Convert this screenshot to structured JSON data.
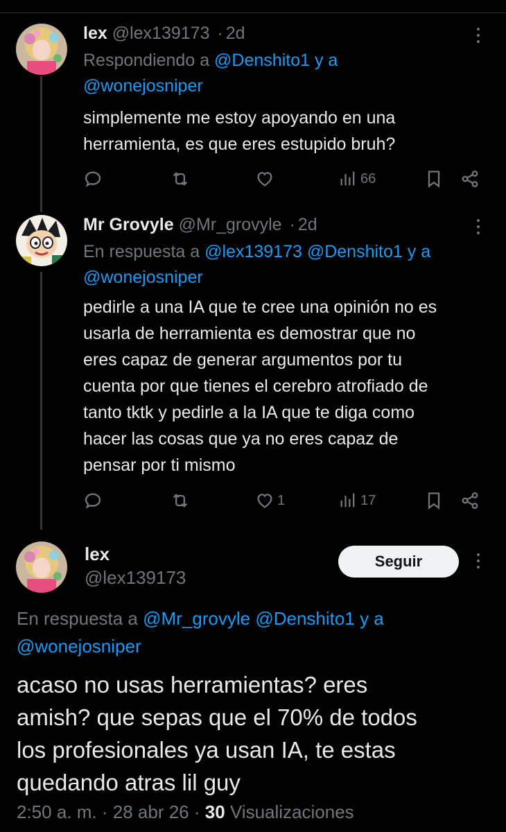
{
  "tweets": [
    {
      "name": "lex",
      "handle": "@lex139173",
      "sep": "·",
      "time": "2d",
      "reply_prefix": "Respondiendo a",
      "reply_users": [
        "@Denshito1",
        "y a",
        "@wonejosniper"
      ],
      "text_lines": [
        "simplemente me estoy apoyando en una",
        "herramienta, es que eres estupido bruh?"
      ],
      "actions": {
        "replies": "",
        "reposts": "",
        "likes": "",
        "views": "66"
      }
    },
    {
      "name": "Mr Grovyle",
      "handle": "@Mr_grovyle",
      "sep": "·",
      "time": "2d",
      "reply_prefix": "En respuesta a",
      "reply_users": [
        "@lex139173",
        "@Denshito1",
        "y a",
        "@wonejosniper"
      ],
      "text_lines": [
        "pedirle a una IA que te cree una opinión no es",
        "usarla de herramienta es demostrar que no",
        "eres capaz de generar argumentos por tu",
        "cuenta por que tienes el cerebro atrofiado de",
        "tanto tktk y pedirle a la IA que te diga como",
        "hacer las cosas que ya no eres capaz de",
        "pensar por ti mismo"
      ],
      "actions": {
        "replies": "",
        "reposts": "",
        "likes": "1",
        "views": "17"
      }
    }
  ],
  "main_tweet": {
    "name": "lex",
    "handle": "@lex139173",
    "follow_label": "Seguir",
    "reply_prefix": "En respuesta a",
    "reply_users": [
      "@Mr_grovyle",
      "@Denshito1",
      "y a",
      "@wonejosniper"
    ],
    "text_lines": [
      "acaso no usas herramientas? eres",
      "amish? que sepas que el 70% de todos",
      "los profesionales ya usan IA, te estas",
      "quedando atras lil guy"
    ],
    "time": "2:50 a. m.",
    "date": "28 abr 26",
    "views_count": "30",
    "views_label": "Visualizaciones",
    "sep": "·"
  },
  "colors": {
    "background": "#000000",
    "text": "#e7e9ea",
    "muted": "#71767b",
    "link": "#1d9bf0",
    "button_bg": "#eff3f4"
  },
  "icons": [
    "reply-icon",
    "repost-icon",
    "like-icon",
    "views-icon",
    "bookmark-icon",
    "share-icon",
    "more-icon"
  ]
}
